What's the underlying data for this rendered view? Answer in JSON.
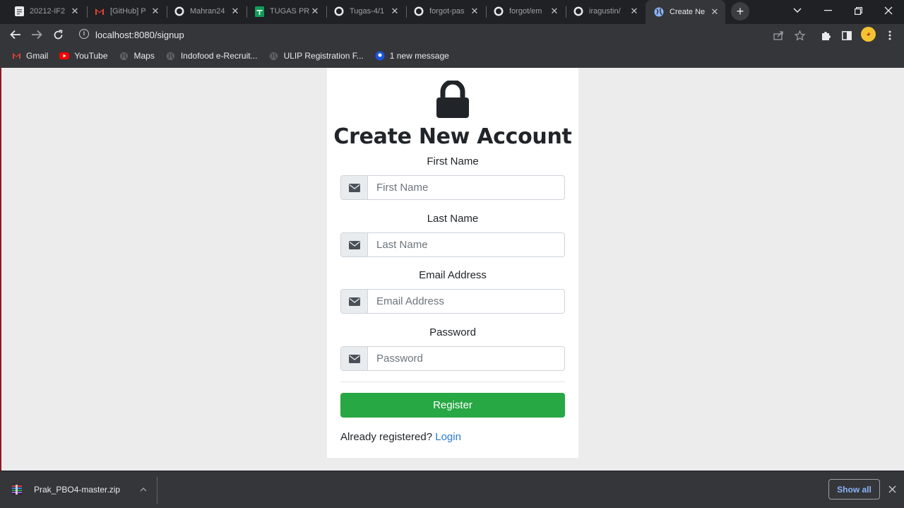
{
  "browser": {
    "tabs": [
      {
        "title": "20212-IF2",
        "icon": "document-icon",
        "color": "#e8eaed"
      },
      {
        "title": "[GitHub] P",
        "icon": "gmail-icon",
        "color": "#ea4335"
      },
      {
        "title": "Mahran24",
        "icon": "github-icon",
        "color": "#e8eaed"
      },
      {
        "title": "TUGAS PR",
        "icon": "sheets-icon",
        "color": "#0f9d58"
      },
      {
        "title": "Tugas-4/1",
        "icon": "github-icon",
        "color": "#e8eaed"
      },
      {
        "title": "forgot-pas",
        "icon": "github-icon",
        "color": "#e8eaed"
      },
      {
        "title": "forgot/em",
        "icon": "github-icon",
        "color": "#e8eaed"
      },
      {
        "title": "iragustin/",
        "icon": "github-icon",
        "color": "#e8eaed"
      },
      {
        "title": "Create Ne",
        "icon": "globe-icon",
        "color": "#e8eaed",
        "active": true
      }
    ],
    "new_tab": "+",
    "url": "localhost:8080/signup",
    "bookmarks": [
      {
        "label": "Gmail",
        "icon": "gmail-icon"
      },
      {
        "label": "YouTube",
        "icon": "youtube-icon"
      },
      {
        "label": "Maps",
        "icon": "globe-icon"
      },
      {
        "label": "Indofood e-Recruit...",
        "icon": "globe-icon"
      },
      {
        "label": "ULIP Registration F...",
        "icon": "globe-icon"
      },
      {
        "label": "1 new message",
        "icon": "messenger-icon"
      }
    ]
  },
  "page": {
    "title": "Create New Account",
    "fields": [
      {
        "label": "First Name",
        "placeholder": "First Name"
      },
      {
        "label": "Last Name",
        "placeholder": "Last Name"
      },
      {
        "label": "Email Address",
        "placeholder": "Email Address"
      },
      {
        "label": "Password",
        "placeholder": "Password"
      }
    ],
    "register_label": "Register",
    "already_text": "Already registered?",
    "login_link": "Login",
    "colors": {
      "primary_button": "#28a745",
      "link": "#2a7ad4"
    }
  },
  "downloads": {
    "file": "Prak_PBO4-master.zip",
    "show_all": "Show all"
  }
}
